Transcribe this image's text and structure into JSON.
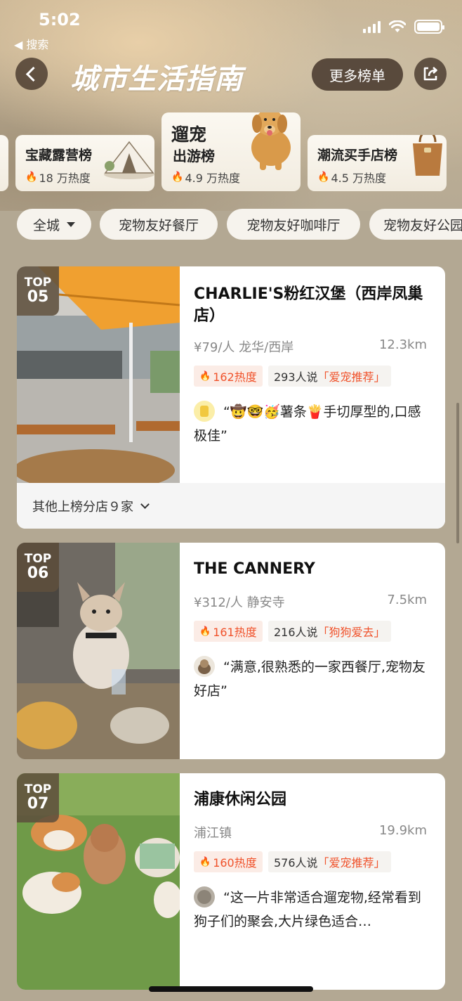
{
  "status_bar": {
    "time": "5:02",
    "back_label": "◀ 搜索"
  },
  "header": {
    "title": "城市生活指南",
    "more_label": "更多榜单"
  },
  "categories": [
    {
      "title": "宝藏露营榜",
      "heat": "18 万热度"
    },
    {
      "title_line1": "遛宠",
      "title_line2": "出游榜",
      "heat": "4.9 万热度"
    },
    {
      "title": "潮流买手店榜",
      "heat": "4.5 万热度"
    }
  ],
  "filters": [
    "全城",
    "宠物友好餐厅",
    "宠物友好咖啡厅",
    "宠物友好公园"
  ],
  "listings": [
    {
      "badge_top": "TOP",
      "rank": "05",
      "name": "CHARLIE'S粉红汉堡（西岸凤巢店）",
      "meta": "¥79/人  龙华/西岸",
      "distance": "12.3km",
      "heat": "162热度",
      "say_prefix": "293人说",
      "say_highlight": "「爱宠推荐」",
      "quote": "“🤠🤓🥳薯条🍟手切厚型的,口感极佳”",
      "branches": "其他上榜分店９家"
    },
    {
      "badge_top": "TOP",
      "rank": "06",
      "name": "THE CANNERY",
      "meta": "¥312/人  静安寺",
      "distance": "7.5km",
      "heat": "161热度",
      "say_prefix": "216人说",
      "say_highlight": "「狗狗爱去」",
      "quote": "“满意,很熟悉的一家西餐厅,宠物友好店”"
    },
    {
      "badge_top": "TOP",
      "rank": "07",
      "name": "浦康休闲公园",
      "meta": "浦江镇",
      "distance": "19.9km",
      "heat": "160热度",
      "say_prefix": "576人说",
      "say_highlight": "「爱宠推荐」",
      "quote": "“这一片非常适合遛宠物,经常看到狗子们的聚会,大片绿色适合…"
    }
  ],
  "colors": {
    "accent": "#f0522b",
    "background": "#b3a893",
    "badge": "#5f503c"
  },
  "icons": [
    "back-arrow-icon",
    "share-icon",
    "flame-icon",
    "chevron-down-icon",
    "caret-down-icon",
    "signal-icon",
    "wifi-icon",
    "battery-icon"
  ]
}
